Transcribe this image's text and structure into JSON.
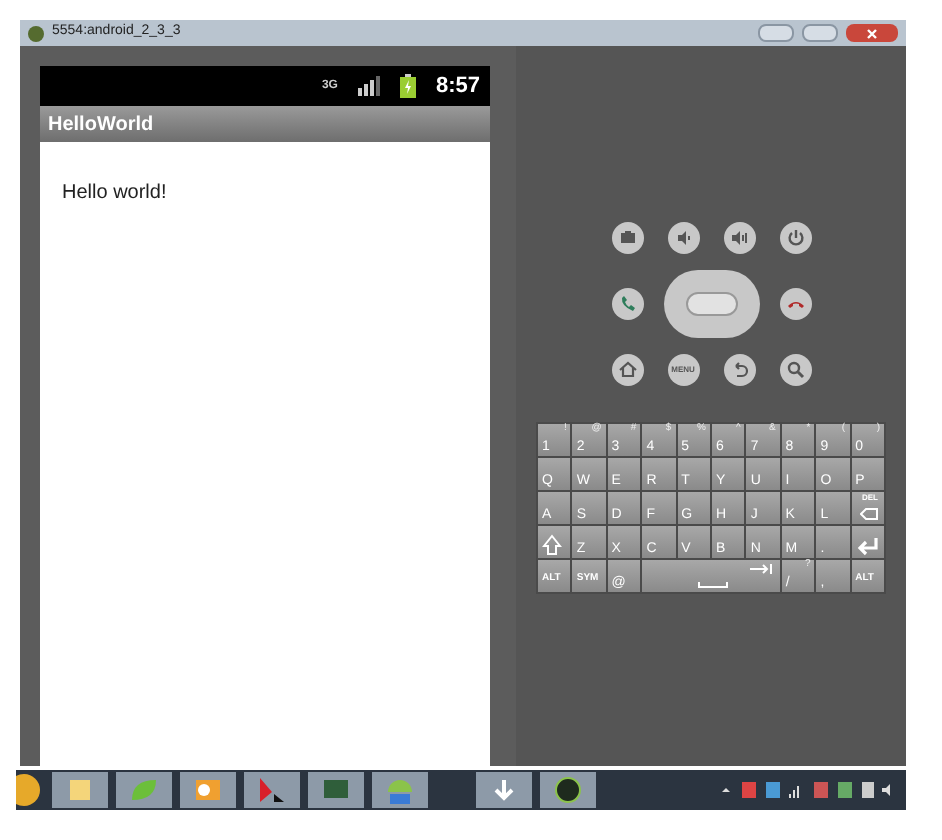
{
  "window": {
    "title": "5554:android_2_3_3"
  },
  "phone": {
    "status_bar": {
      "network": "3G",
      "time": "8:57"
    },
    "app_title": "HelloWorld",
    "content": "Hello world!"
  },
  "keyboard": {
    "rows": [
      [
        {
          "label": "1",
          "alt": "!"
        },
        {
          "label": "2",
          "alt": "@"
        },
        {
          "label": "3",
          "alt": "#"
        },
        {
          "label": "4",
          "alt": "$"
        },
        {
          "label": "5",
          "alt": "%"
        },
        {
          "label": "6",
          "alt": "^"
        },
        {
          "label": "7",
          "alt": "&"
        },
        {
          "label": "8",
          "alt": "*"
        },
        {
          "label": "9",
          "alt": "("
        },
        {
          "label": "0",
          "alt": ")"
        }
      ],
      [
        {
          "label": "Q"
        },
        {
          "label": "W"
        },
        {
          "label": "E"
        },
        {
          "label": "R"
        },
        {
          "label": "T"
        },
        {
          "label": "Y"
        },
        {
          "label": "U"
        },
        {
          "label": "I"
        },
        {
          "label": "O"
        },
        {
          "label": "P"
        }
      ],
      [
        {
          "label": "A"
        },
        {
          "label": "S"
        },
        {
          "label": "D"
        },
        {
          "label": "F"
        },
        {
          "label": "G"
        },
        {
          "label": "H"
        },
        {
          "label": "J"
        },
        {
          "label": "K"
        },
        {
          "label": "L"
        },
        {
          "label": "DEL",
          "kind": "delete"
        }
      ],
      [
        {
          "kind": "shift"
        },
        {
          "label": "Z"
        },
        {
          "label": "X"
        },
        {
          "label": "C"
        },
        {
          "label": "V"
        },
        {
          "label": "B"
        },
        {
          "label": "N"
        },
        {
          "label": "M"
        },
        {
          "label": "."
        },
        {
          "kind": "enter"
        }
      ]
    ],
    "bottom_row": [
      {
        "label": "ALT"
      },
      {
        "label": "SYM"
      },
      {
        "label": "@"
      },
      {
        "kind": "space"
      },
      {
        "label": "/",
        "alt": "?"
      },
      {
        "label": ","
      },
      {
        "label": "ALT"
      }
    ]
  },
  "menu_button_label": "MENU"
}
